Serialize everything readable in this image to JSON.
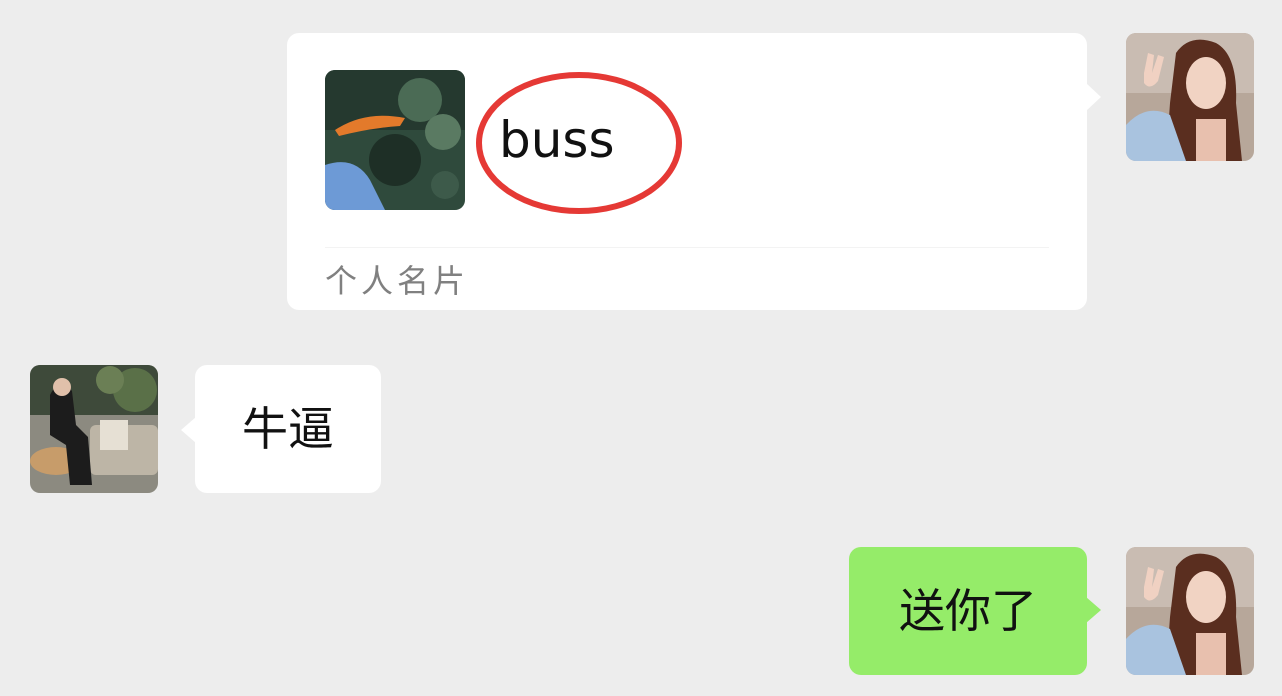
{
  "messages": [
    {
      "direction": "sent",
      "kind": "contact_card",
      "sender_avatar": "user-avatar-selfie",
      "card": {
        "name": "buss",
        "thumbnail": "koi-fish-pond-image",
        "type_label": "个人名片",
        "highlight": "red-circle-annotation"
      }
    },
    {
      "direction": "received",
      "kind": "text",
      "sender_avatar": "contact-avatar-seated-person",
      "text": "牛逼"
    },
    {
      "direction": "sent",
      "kind": "text",
      "sender_avatar": "user-avatar-selfie",
      "text": "送你了"
    }
  ],
  "colors": {
    "background": "#ededed",
    "bubble_received": "#ffffff",
    "bubble_sent": "#95ec69",
    "annotation": "#e53935",
    "card_label": "#808080"
  }
}
